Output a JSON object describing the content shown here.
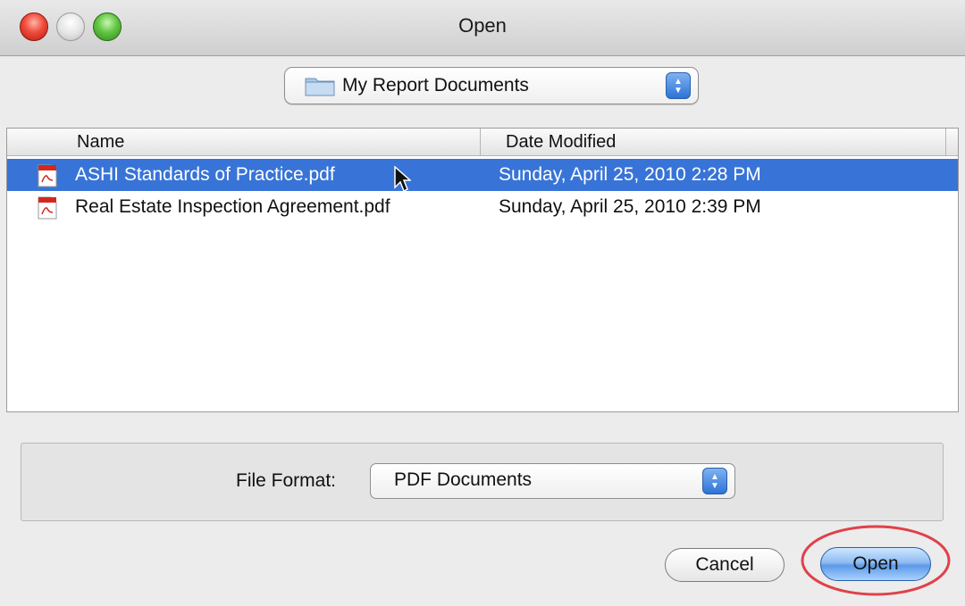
{
  "window": {
    "title": "Open"
  },
  "location": {
    "selected": "My Report Documents",
    "icon": "folder-icon"
  },
  "file_list": {
    "columns": [
      "Name",
      "Date Modified"
    ],
    "rows": [
      {
        "name": "ASHI Standards of Practice.pdf",
        "date": "Sunday, April 25, 2010 2:28 PM",
        "selected": true,
        "icon": "pdf-icon"
      },
      {
        "name": "Real Estate Inspection Agreement.pdf",
        "date": "Sunday, April 25, 2010 2:39 PM",
        "selected": false,
        "icon": "pdf-icon"
      }
    ]
  },
  "format": {
    "label": "File Format:",
    "value": "PDF Documents"
  },
  "buttons": {
    "cancel": "Cancel",
    "open": "Open"
  },
  "colors": {
    "selection": "#3874d7",
    "highlight_ring": "#e0414a"
  }
}
